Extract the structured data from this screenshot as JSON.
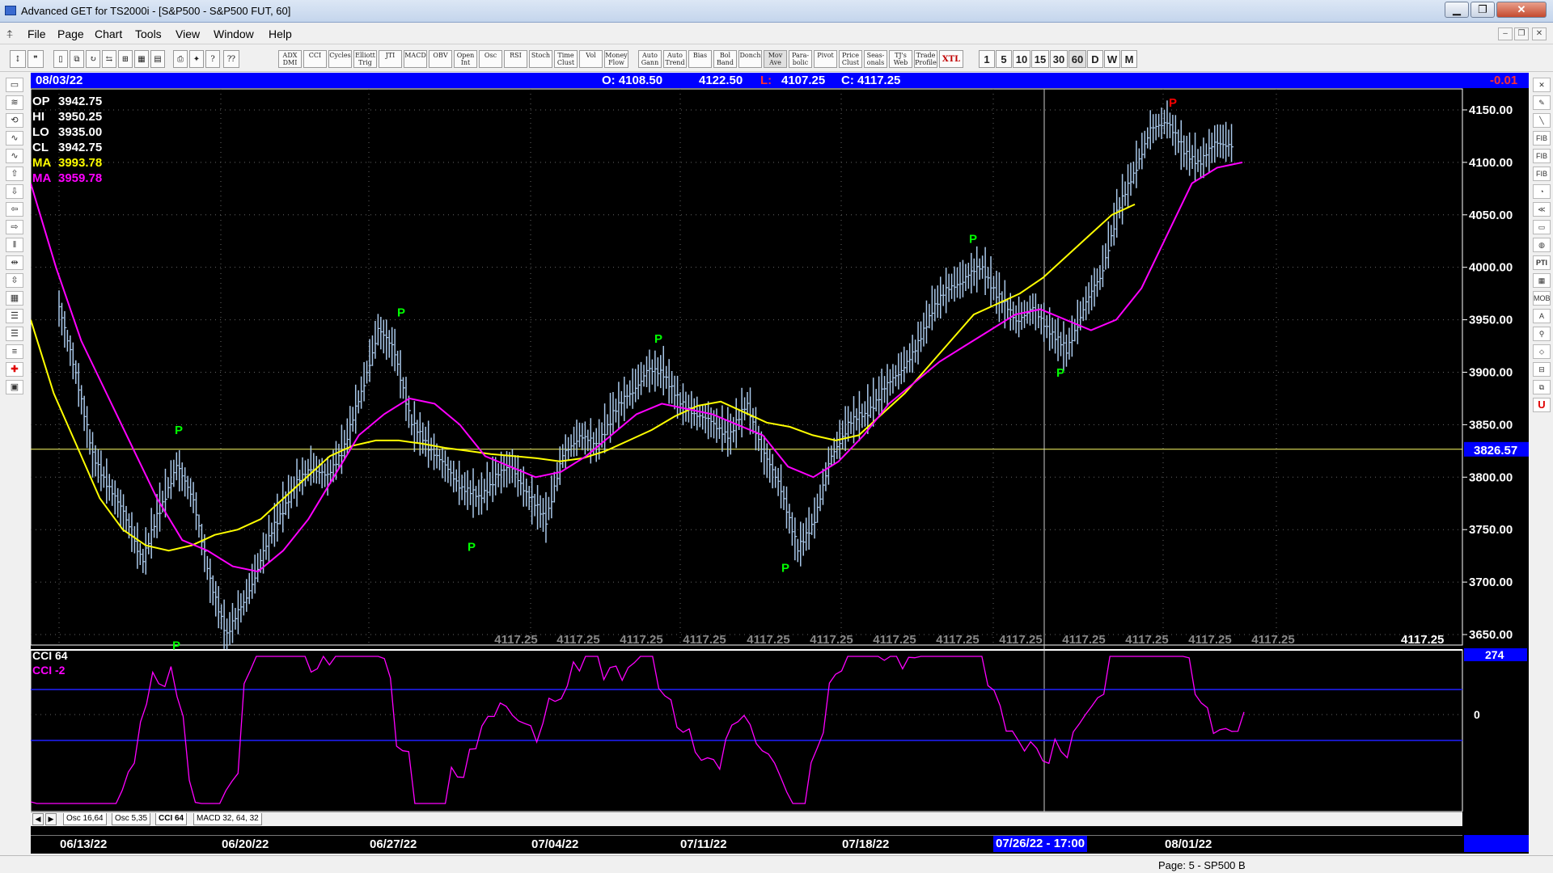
{
  "window": {
    "title": "Advanced GET for TS2000i - [S&P500 - S&P500 FUT, 60]"
  },
  "menu": [
    "File",
    "Page",
    "Chart",
    "Tools",
    "View",
    "Window",
    "Help"
  ],
  "toolbar": {
    "studies": [
      {
        "id": "adx",
        "label": "ADX DMI"
      },
      {
        "id": "cci",
        "label": "CCI"
      },
      {
        "id": "cycles",
        "label": "Cycles"
      },
      {
        "id": "elliott",
        "label": "Elliott Trig"
      },
      {
        "id": "jti",
        "label": "JTI"
      },
      {
        "id": "macd",
        "label": "MACD"
      },
      {
        "id": "obv",
        "label": "OBV"
      },
      {
        "id": "open-int",
        "label": "Open Int"
      },
      {
        "id": "osc",
        "label": "Osc"
      },
      {
        "id": "rsi",
        "label": "RSI"
      },
      {
        "id": "stoch",
        "label": "Stoch"
      },
      {
        "id": "time-clust",
        "label": "Time Clust"
      },
      {
        "id": "vol",
        "label": "Vol"
      },
      {
        "id": "money-flow",
        "label": "Money Flow"
      },
      {
        "id": "auto-gann",
        "label": "Auto Gann"
      },
      {
        "id": "auto-trend",
        "label": "Auto Trend"
      },
      {
        "id": "bias",
        "label": "Bias"
      },
      {
        "id": "bol-band",
        "label": "Bol Band"
      },
      {
        "id": "donch",
        "label": "Donch"
      },
      {
        "id": "mov-ave",
        "label": "Mov Ave"
      },
      {
        "id": "parabolic",
        "label": "Para- bolic"
      },
      {
        "id": "pivot",
        "label": "Pivot"
      },
      {
        "id": "price-clust",
        "label": "Price Clust"
      },
      {
        "id": "seasonals",
        "label": "Seas- onals"
      },
      {
        "id": "tjs-web",
        "label": "TJ's Web"
      },
      {
        "id": "trade-profile",
        "label": "Trade Profile"
      },
      {
        "id": "xtl",
        "label": "XTL"
      }
    ],
    "timeframes": [
      "1",
      "5",
      "10",
      "15",
      "30",
      "60",
      "D",
      "W",
      "M"
    ],
    "selected_timeframe": "60"
  },
  "info": {
    "date": "08/03/22",
    "open": "O: 4108.50",
    "high": "4122.50",
    "low_label": "L:",
    "low": "4107.25",
    "close": "C: 4117.25",
    "change": "-0.01"
  },
  "ohlc_legend": [
    {
      "k": "OP",
      "v": "3942.75",
      "color": "#ffffff"
    },
    {
      "k": "HI",
      "v": "3950.25",
      "color": "#ffffff"
    },
    {
      "k": "LO",
      "v": "3935.00",
      "color": "#ffffff"
    },
    {
      "k": "CL",
      "v": "3942.75",
      "color": "#ffffff"
    },
    {
      "k": "MA",
      "v": "3993.78",
      "color": "#ffff00"
    },
    {
      "k": "MA",
      "v": "3959.78",
      "color": "#ff00ff"
    }
  ],
  "price_axis": [
    "4150.00",
    "4100.00",
    "4050.00",
    "4000.00",
    "3950.00",
    "3900.00",
    "3850.00",
    "3800.00",
    "3750.00",
    "3700.00",
    "3650.00"
  ],
  "cursor_price": "3826.57",
  "repeat_price": "4117.25",
  "last_price": "4117.25",
  "pivot_label": "P",
  "cci": {
    "title": "CCI 64",
    "sub": "CCI  -2",
    "value": "274",
    "zero": "0"
  },
  "tabs": [
    "Osc 16,64",
    "Osc 5,35",
    "CCI 64",
    "MACD 32, 64, 32"
  ],
  "dates": [
    "06/13/22",
    "06/20/22",
    "06/27/22",
    "07/04/22",
    "07/11/22",
    "07/18/22",
    "08/01/22"
  ],
  "cursor_date": "07/26/22 - 17:00",
  "status": "Page: 5 - SP500 B",
  "colors": {
    "ma_fast": "#ffff00",
    "ma_slow": "#ff00ff",
    "bars": "#a9c8ea",
    "pivot_low": "#00ff00",
    "pivot_high": "#ff0000",
    "accent": "#0000ff"
  },
  "chart_data": {
    "type": "line",
    "ylim": [
      3640,
      4170
    ],
    "series": [
      {
        "values": [
          3960,
          3900,
          3820,
          3790,
          3760,
          3720,
          3770,
          3810,
          3780,
          3700,
          3650,
          3680,
          3720,
          3760,
          3790,
          3810,
          3800,
          3830,
          3880,
          3940,
          3920,
          3850,
          3830,
          3810,
          3790,
          3780,
          3800,
          3810,
          3780,
          3760,
          3820,
          3840,
          3830,
          3860,
          3880,
          3900,
          3900,
          3870,
          3860,
          3850,
          3840,
          3870,
          3820,
          3790,
          3730,
          3760,
          3820,
          3850,
          3860,
          3880,
          3900,
          3920,
          3960,
          3980,
          3990,
          4000,
          3970,
          3950,
          3960,
          3940,
          3920,
          3960,
          3990,
          4050,
          4090,
          4130,
          4140,
          4110,
          4100,
          4120,
          4117
        ]
      },
      {
        "name": "MA",
        "values": [
          3950,
          3880,
          3830,
          3780,
          3750,
          3735,
          3730,
          3735,
          3745,
          3750,
          3760,
          3780,
          3800,
          3820,
          3830,
          3835,
          3835,
          3832,
          3828,
          3825,
          3822,
          3820,
          3818,
          3815,
          3818,
          3825,
          3835,
          3845,
          3858,
          3868,
          3872,
          3862,
          3852,
          3848,
          3840,
          3835,
          3840,
          3860,
          3880,
          3905,
          3930,
          3955,
          3965,
          3975,
          3990,
          4010,
          4030,
          4050,
          4060
        ]
      },
      {
        "name": "MA",
        "values": [
          4080,
          4000,
          3930,
          3880,
          3830,
          3780,
          3740,
          3730,
          3715,
          3710,
          3730,
          3760,
          3800,
          3840,
          3860,
          3875,
          3870,
          3850,
          3820,
          3810,
          3800,
          3805,
          3820,
          3840,
          3860,
          3870,
          3865,
          3860,
          3850,
          3840,
          3810,
          3800,
          3815,
          3840,
          3870,
          3890,
          3910,
          3925,
          3940,
          3955,
          3960,
          3950,
          3940,
          3950,
          3980,
          4030,
          4080,
          4095,
          4100
        ]
      }
    ]
  }
}
